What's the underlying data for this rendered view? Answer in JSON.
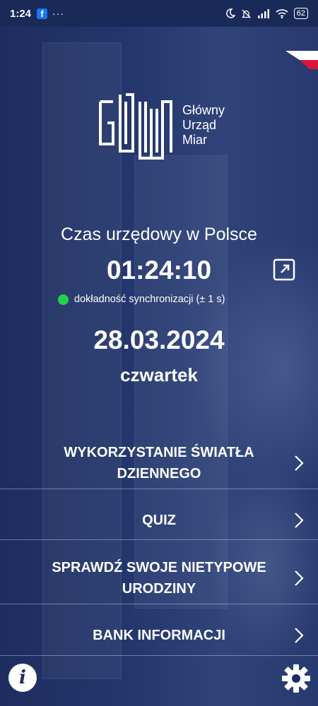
{
  "status_bar": {
    "time": "1:24",
    "app_icon": "f",
    "more": "···",
    "battery": "62"
  },
  "brand": {
    "line1": "Główny",
    "line2": "Urząd",
    "line3": "Miar"
  },
  "heading": "Czas urzędowy w Polsce",
  "clock": "01:24:10",
  "sync_text": "dokładność synchronizacji (± 1 s)",
  "date": "28.03.2024",
  "weekday": "czwartek",
  "menu": [
    {
      "label": "WYKORZYSTANIE ŚWIATŁA DZIENNEGO"
    },
    {
      "label": "QUIZ"
    },
    {
      "label": "SPRAWDŹ SWOJE NIETYPOWE URODZINY"
    },
    {
      "label": "BANK INFORMACJI"
    }
  ],
  "colors": {
    "background": "#1c2c5e",
    "sync_ok": "#21d34a",
    "flag_white": "#ffffff",
    "flag_red": "#dc143c"
  },
  "icons": [
    "facebook-icon",
    "moon-icon",
    "mute-icon",
    "signal-icon",
    "wifi-icon",
    "battery-icon",
    "flag-icon",
    "expand-icon",
    "chevron-right-icon",
    "info-icon",
    "gear-icon"
  ]
}
